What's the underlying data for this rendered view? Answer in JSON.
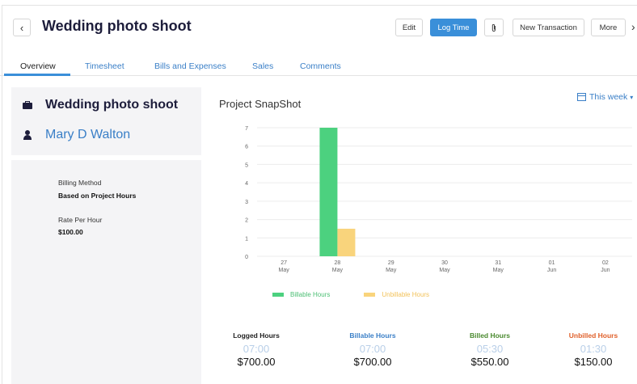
{
  "header": {
    "title": "Wedding photo shoot",
    "buttons": {
      "edit": "Edit",
      "log_time": "Log Time",
      "new_transaction": "New Transaction",
      "more": "More"
    },
    "icons": {
      "back": "chevron-left-icon",
      "attach": "paperclip-icon",
      "next": "chevron-right-icon"
    }
  },
  "tabs": [
    "Overview",
    "Timesheet",
    "Bills and Expenses",
    "Sales",
    "Comments"
  ],
  "active_tab": "Overview",
  "project_panel": {
    "project_name": "Wedding photo shoot",
    "customer_name": "Mary D Walton",
    "billing_method_label": "Billing Method",
    "billing_method_value": "Based on Project Hours",
    "rate_label": "Rate Per Hour",
    "rate_value": "$100.00"
  },
  "snapshot": {
    "title": "Project SnapShot",
    "period": "This week",
    "legend": {
      "billable": "Billable Hours",
      "unbillable": "Unbillable Hours"
    }
  },
  "colors": {
    "accent": "#3a8fd9",
    "billable": "#4cd17f",
    "unbillable": "#f9d47c",
    "billed_label": "#4a8a2f",
    "unbilled_label": "#e0602a"
  },
  "chart_data": {
    "type": "bar",
    "categories": [
      [
        "27",
        "May"
      ],
      [
        "28",
        "May"
      ],
      [
        "29",
        "May"
      ],
      [
        "30",
        "May"
      ],
      [
        "31",
        "May"
      ],
      [
        "01",
        "Jun"
      ],
      [
        "02",
        "Jun"
      ]
    ],
    "series": [
      {
        "name": "Billable Hours",
        "values": [
          0,
          7,
          0,
          0,
          0,
          0,
          0
        ]
      },
      {
        "name": "Unbillable Hours",
        "values": [
          0,
          1.5,
          0,
          0,
          0,
          0,
          0
        ]
      }
    ],
    "yticks": [
      0,
      1,
      2,
      3,
      4,
      5,
      6,
      7
    ],
    "ylim": [
      0,
      7
    ]
  },
  "stats": [
    {
      "label": "Logged Hours",
      "hours": "07:00",
      "amount": "$700.00"
    },
    {
      "label": "Billable Hours",
      "hours": "07:00",
      "amount": "$700.00"
    },
    {
      "label": "Billed Hours",
      "hours": "05:30",
      "amount": "$550.00"
    },
    {
      "label": "Unbilled Hours",
      "hours": "01:30",
      "amount": "$150.00"
    }
  ]
}
